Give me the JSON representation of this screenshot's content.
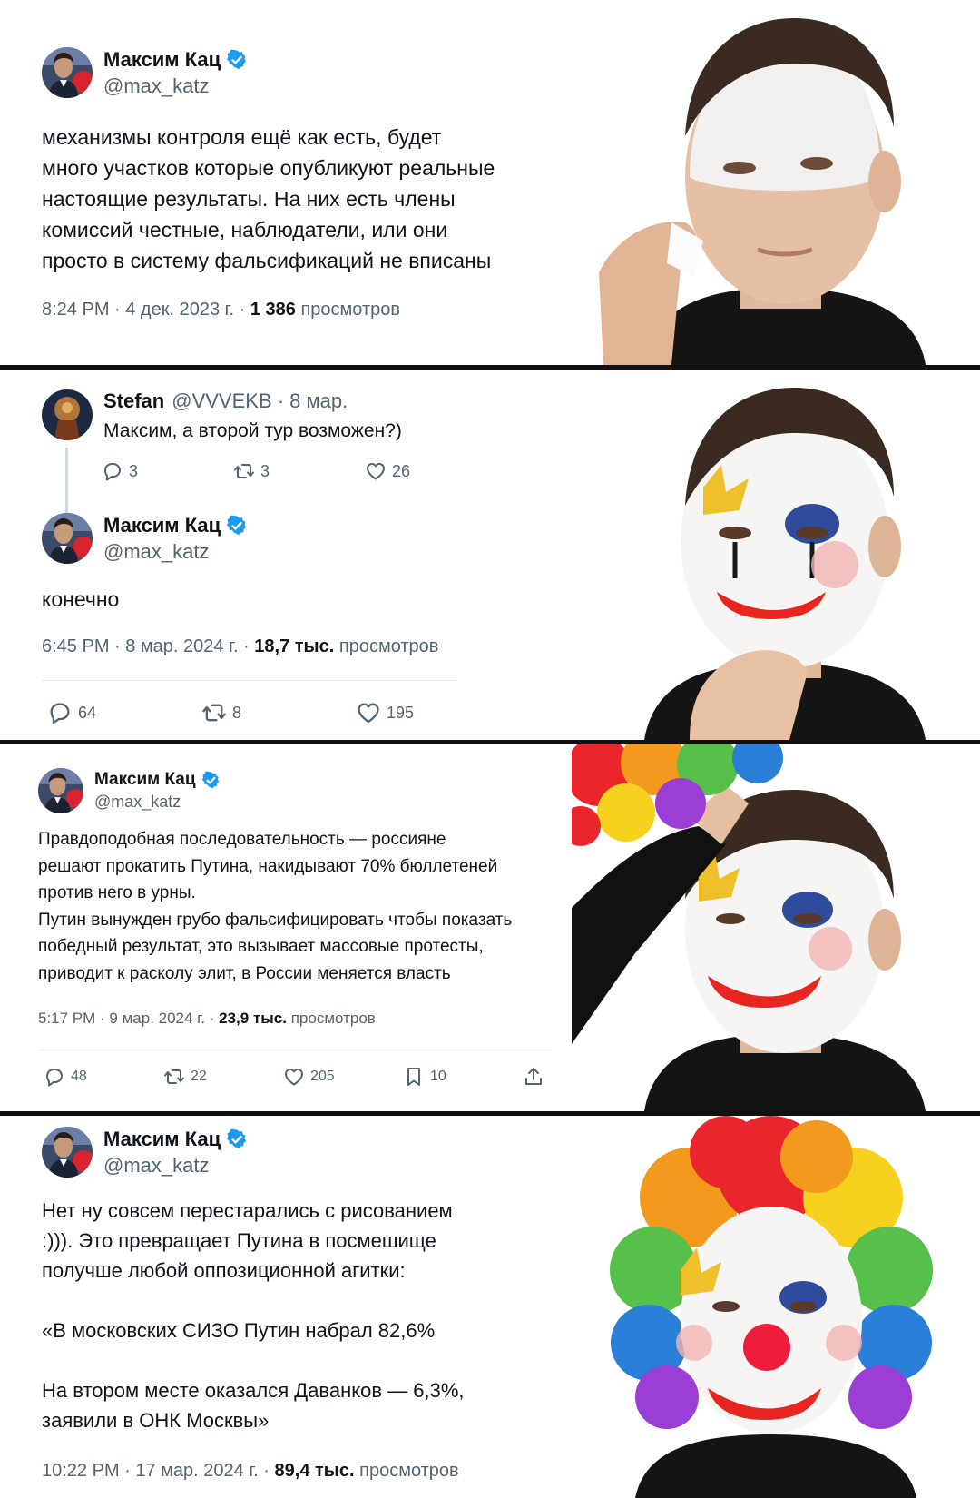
{
  "panel1": {
    "name": "Максим Кац",
    "handle": "@max_katz",
    "text": "механизмы контроля ещё как есть, будет\nмного участков которые опубликуют реальные\nнастоящие результаты. На них есть члены\nкомиссий честные, наблюдатели, или они\nпросто в систему фальсификаций не вписаны",
    "time": "8:24 PM · 4 дек. 2023 г. · ",
    "views": "1 386",
    "views_label": "просмотров"
  },
  "panel2": {
    "reply_name": "Stefan",
    "reply_handle_date": "@VVVEKB · 8 мар.",
    "reply_text": "Максим, а второй тур возможен?)",
    "reply_replies": "3",
    "reply_retweets": "3",
    "reply_likes": "26",
    "name": "Максим Кац",
    "handle": "@max_katz",
    "text": "конечно",
    "time": "6:45 PM · 8 мар. 2024 г. · ",
    "views": "18,7 тыс.",
    "views_label": "просмотров",
    "replies": "64",
    "retweets": "8",
    "likes": "195"
  },
  "panel3": {
    "name": "Максим Кац",
    "handle": "@max_katz",
    "text": "Правдоподобная последовательность — россияне\nрешают прокатить Путина, накидывают 70% бюллетеней\nпротив него в урны.\nПутин вынужден грубо фальсифицировать чтобы показать\nпобедный результат, это вызывает массовые протесты,\nприводит к расколу элит, в России меняется власть",
    "time": "5:17 PM · 9 мар. 2024 г. · ",
    "views": "23,9 тыс.",
    "views_label": "просмотров",
    "replies": "48",
    "retweets": "22",
    "likes": "205",
    "bookmarks": "10"
  },
  "panel4": {
    "name": "Максим Кац",
    "handle": "@max_katz",
    "text": "Нет ну совсем перестарались с рисованием\n:))). Это превращает Путина в посмешище\nполучше любой оппозиционной агитки:\n\n«В московских СИЗО Путин набрал 82,6%\n\nНа втором месте оказался Даванков — 6,3%,\nзаявили в ОНК Москвы»",
    "time": "10:22 PM · 17 мар. 2024 г. · ",
    "views": "89,4 тыс.",
    "views_label": "просмотров"
  },
  "colors": {
    "verified": "#1d9bf0",
    "text": "#0f1419",
    "muted": "#536471",
    "divider": "#111111"
  },
  "icons": [
    "verified-badge-icon",
    "reply-icon",
    "retweet-icon",
    "like-icon",
    "bookmark-icon",
    "share-icon"
  ]
}
